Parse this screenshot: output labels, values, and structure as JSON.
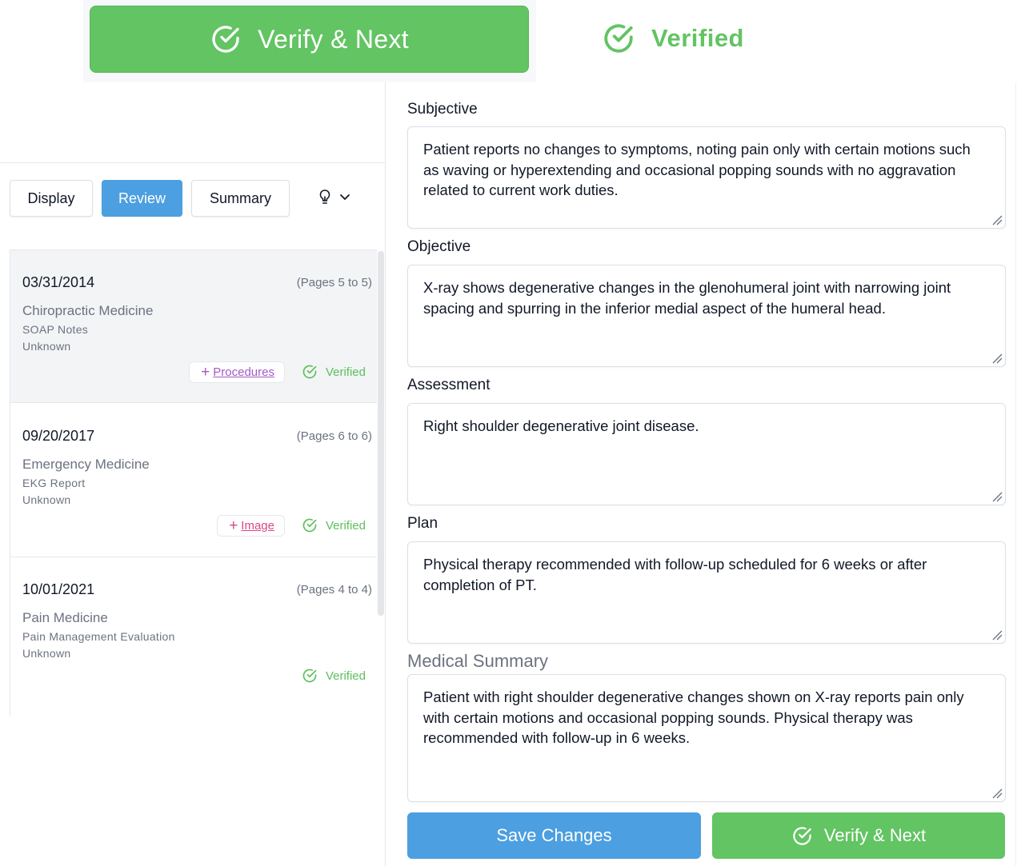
{
  "top_preview": {
    "verify_next_label": "Verify & Next",
    "verified_label": "Verified"
  },
  "tabs": [
    {
      "label": "Display",
      "active": false
    },
    {
      "label": "Review",
      "active": true
    },
    {
      "label": "Summary",
      "active": false
    }
  ],
  "tips_toggle": {
    "icon": "lightbulb-icon",
    "chevron": "chevron-down-icon"
  },
  "records": [
    {
      "date": "03/31/2014",
      "pages": "(Pages 5 to 5)",
      "specialty": "Chiropractic Medicine",
      "type": "SOAP Notes",
      "provider": "Unknown",
      "action": "Procedures",
      "status": "Verified",
      "selected": true
    },
    {
      "date": "09/20/2017",
      "pages": "(Pages 6 to 6)",
      "specialty": "Emergency Medicine",
      "type": "EKG Report",
      "provider": "Unknown",
      "action": "Image",
      "status": "Verified",
      "selected": false
    },
    {
      "date": "10/01/2021",
      "pages": "(Pages 4 to 4)",
      "specialty": "Pain Medicine",
      "type": "Pain Management Evaluation",
      "provider": "Unknown",
      "action": "",
      "status": "Verified",
      "selected": false
    }
  ],
  "soap": {
    "subjective": {
      "label": "Subjective",
      "value": "Patient reports no changes to symptoms, noting pain only with certain motions such as waving or hyperextending and occasional popping sounds with no aggravation related to current work duties."
    },
    "objective": {
      "label": "Objective",
      "value": "X-ray shows degenerative changes in the glenohumeral joint with narrowing joint spacing and spurring in the inferior medial aspect of the humeral head."
    },
    "assessment": {
      "label": "Assessment",
      "value": "Right shoulder degenerative joint disease."
    },
    "plan": {
      "label": "Plan",
      "value": "Physical therapy recommended with follow-up scheduled for 6 weeks or after completion of PT."
    }
  },
  "medical_summary": {
    "label": "Medical Summary",
    "value": "Patient with right shoulder degenerative changes shown on X-ray reports pain only with certain motions and occasional popping sounds. Physical therapy was recommended with follow-up in 6 weeks."
  },
  "actions": {
    "save_label": "Save Changes",
    "verify_next_label": "Verify & Next"
  },
  "colors": {
    "accent_blue": "#4c9fe0",
    "success_green": "#62c462",
    "procedures_purple": "#a25ac5",
    "image_pink": "#d9488a"
  }
}
